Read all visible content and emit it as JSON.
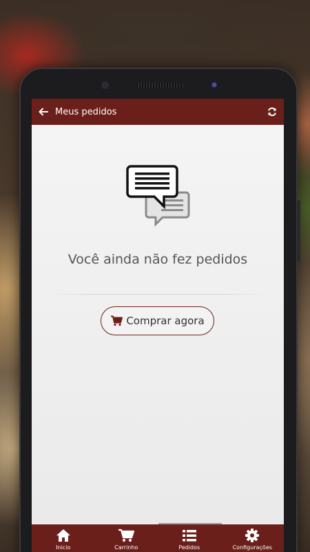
{
  "header": {
    "title": "Meus pedidos",
    "back_icon": "arrow-left-icon",
    "refresh_icon": "refresh-icon"
  },
  "empty_state": {
    "icon": "chat-bubbles-icon",
    "message": "Você ainda não fez pedidos",
    "button_label": "Comprar agora",
    "button_icon": "cart-icon"
  },
  "tabs": [
    {
      "label": "Inicio",
      "icon": "home-icon"
    },
    {
      "label": "Carrinho",
      "icon": "cart-icon"
    },
    {
      "label": "Pedidos",
      "icon": "list-icon"
    },
    {
      "label": "Configurações",
      "icon": "gear-icon"
    }
  ],
  "colors": {
    "brand": "#6b1f1a",
    "background": "#f0f0f0"
  }
}
